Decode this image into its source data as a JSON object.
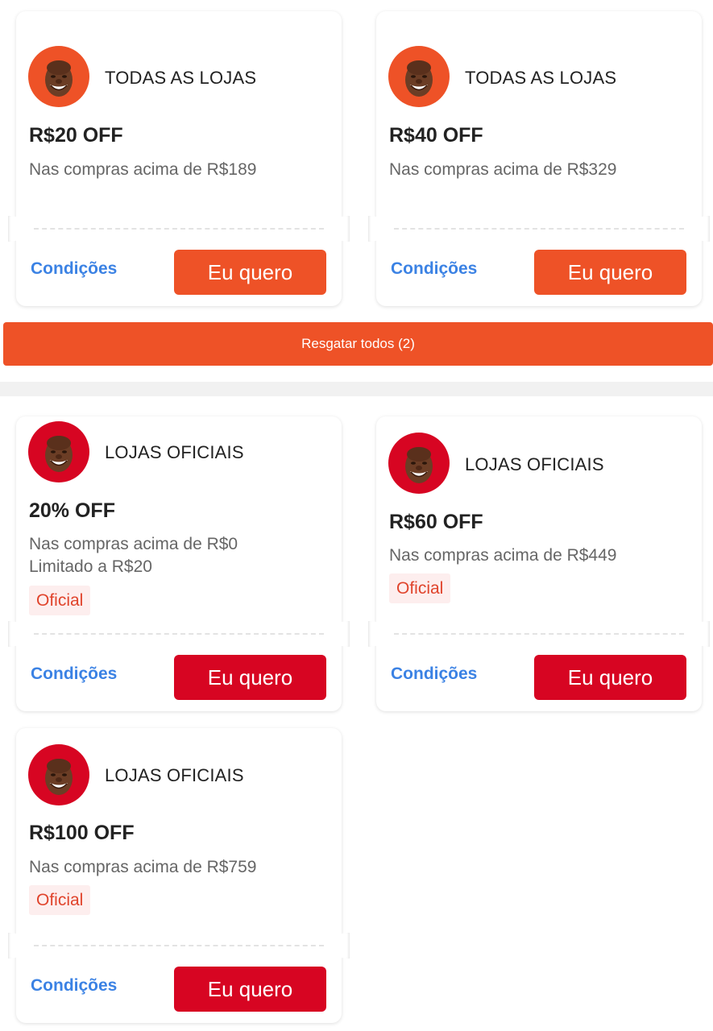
{
  "top_section": {
    "coupons": [
      {
        "store": "TODAS AS LOJAS",
        "amount": "R$20 OFF",
        "condition": "Nas compras acima de R$189",
        "conditions_link": "Condições",
        "cta": "Eu quero"
      },
      {
        "store": "TODAS AS LOJAS",
        "amount": "R$40 OFF",
        "condition": "Nas compras acima de R$329",
        "conditions_link": "Condições",
        "cta": "Eu quero"
      }
    ],
    "claim_all_label": "Resgatar todos (2)"
  },
  "official_section": {
    "coupons": [
      {
        "store": "LOJAS OFICIAIS",
        "amount": "20% OFF",
        "condition": "Nas compras acima de R$0",
        "limit": "Limitado a R$20",
        "badge": "Oficial",
        "conditions_link": "Condições",
        "cta": "Eu quero"
      },
      {
        "store": "LOJAS OFICIAIS",
        "amount": "R$60 OFF",
        "condition": "Nas compras acima de R$449",
        "badge": "Oficial",
        "conditions_link": "Condições",
        "cta": "Eu quero"
      },
      {
        "store": "LOJAS OFICIAIS",
        "amount": "R$100 OFF",
        "condition": "Nas compras acima de R$759",
        "badge": "Oficial",
        "conditions_link": "Condições",
        "cta": "Eu quero"
      }
    ]
  },
  "colors": {
    "accent_orange": "#ee5227",
    "accent_red": "#d70522",
    "link_blue": "#3b82e4",
    "badge_bg": "#fdeeee"
  }
}
